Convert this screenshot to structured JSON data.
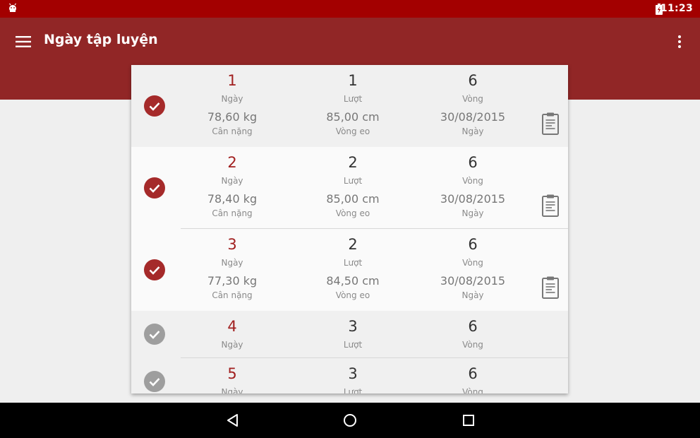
{
  "statusbar": {
    "time": "11:23"
  },
  "appbar": {
    "title": "Ngày tập luyện"
  },
  "colors": {
    "accent": "#912626",
    "status": "#a30000",
    "done": "#a52a2a",
    "pending": "#9e9e9e"
  },
  "rows": [
    {
      "day": "1",
      "day_label": "Ngày",
      "turn": "1",
      "turn_label": "Lượt",
      "round": "6",
      "round_label": "Vòng",
      "weight": "78,60 kg",
      "weight_label": "Cân nặng",
      "waist": "85,00 cm",
      "waist_label": "Vòng eo",
      "date": "30/08/2015",
      "date_label": "Ngày",
      "done": true
    },
    {
      "day": "2",
      "day_label": "Ngày",
      "turn": "2",
      "turn_label": "Lượt",
      "round": "6",
      "round_label": "Vòng",
      "weight": "78,40 kg",
      "weight_label": "Cân nặng",
      "waist": "85,00 cm",
      "waist_label": "Vòng eo",
      "date": "30/08/2015",
      "date_label": "Ngày",
      "done": true
    },
    {
      "day": "3",
      "day_label": "Ngày",
      "turn": "2",
      "turn_label": "Lượt",
      "round": "6",
      "round_label": "Vòng",
      "weight": "77,30 kg",
      "weight_label": "Cân nặng",
      "waist": "84,50 cm",
      "waist_label": "Vòng eo",
      "date": "30/08/2015",
      "date_label": "Ngày",
      "done": true
    },
    {
      "day": "4",
      "day_label": "Ngày",
      "turn": "3",
      "turn_label": "Lượt",
      "round": "6",
      "round_label": "Vòng",
      "done": false
    },
    {
      "day": "5",
      "day_label": "Ngày",
      "turn": "3",
      "turn_label": "Lượt",
      "round": "6",
      "round_label": "Vòng",
      "done": false
    }
  ],
  "icons": {
    "menu": "menu-icon",
    "more": "more-vert-icon",
    "check": "check-circle-icon",
    "clipboard": "clipboard-icon",
    "back": "back-icon",
    "home": "home-icon",
    "recents": "recents-icon"
  }
}
